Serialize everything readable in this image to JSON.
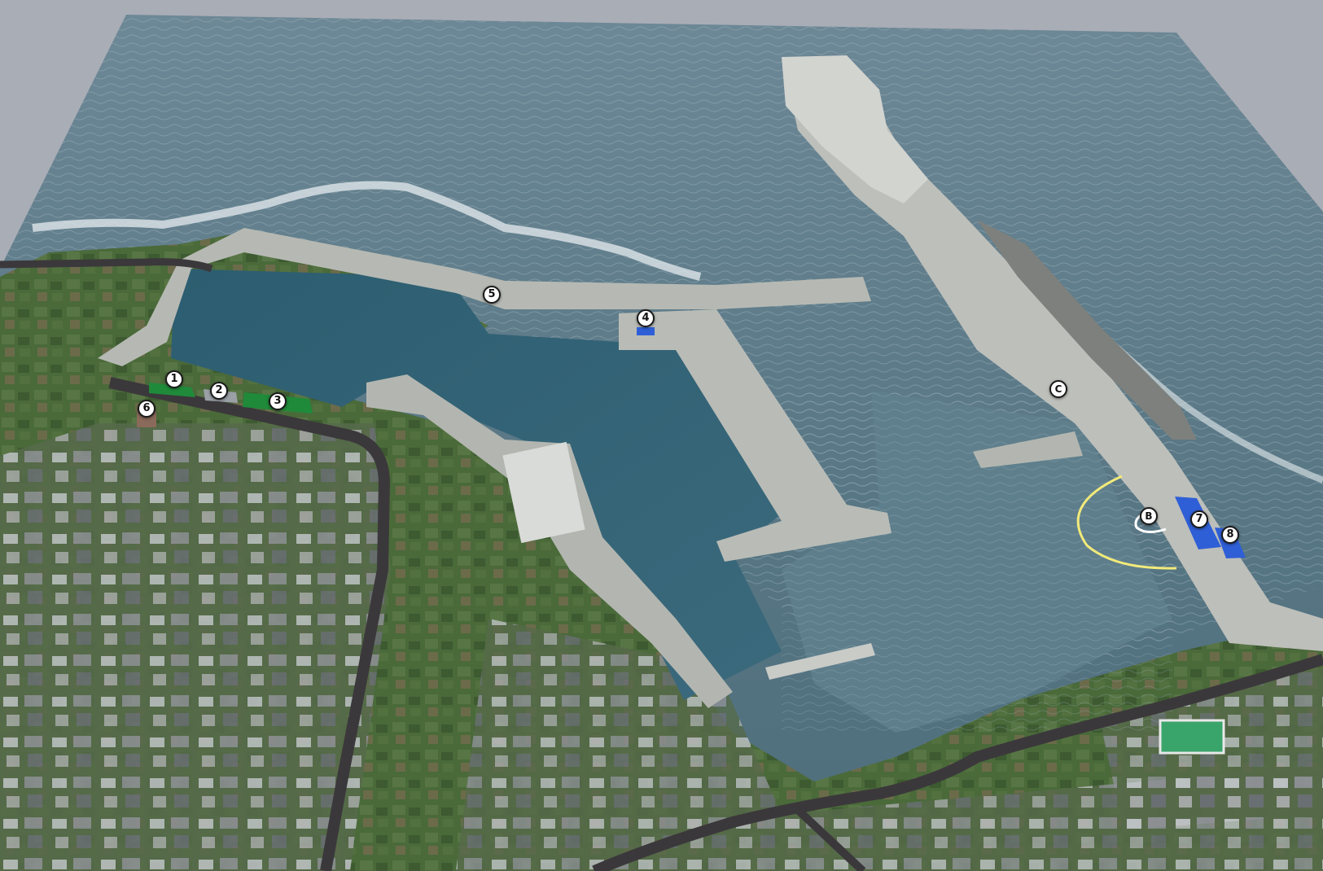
{
  "map": {
    "colors": {
      "background": "#a9adb6",
      "sea": "#5f7f8f",
      "sea_deep": "#3f6474",
      "harbor_water": "#2f5f74",
      "land": "#4c6b3c",
      "concrete": "#b9bcb6",
      "road": "#3b383b",
      "green_building": "#1f8a3a",
      "blue_building": "#2f5fd6",
      "arc_yellow": "#f2ea7a",
      "marker_fill": "#ffffff",
      "marker_border": "#1a1a1a"
    },
    "markers": [
      {
        "id": "1",
        "label": "1",
        "kind": "numbered-marker"
      },
      {
        "id": "2",
        "label": "2",
        "kind": "numbered-marker"
      },
      {
        "id": "3",
        "label": "3",
        "kind": "numbered-marker"
      },
      {
        "id": "4",
        "label": "4",
        "kind": "numbered-marker"
      },
      {
        "id": "5",
        "label": "5",
        "kind": "numbered-marker"
      },
      {
        "id": "6",
        "label": "6",
        "kind": "numbered-marker"
      },
      {
        "id": "7",
        "label": "7",
        "kind": "numbered-marker"
      },
      {
        "id": "8",
        "label": "8",
        "kind": "numbered-marker"
      },
      {
        "id": "B",
        "label": "B",
        "kind": "lettered-marker"
      },
      {
        "id": "C",
        "label": "C",
        "kind": "lettered-marker"
      }
    ]
  }
}
